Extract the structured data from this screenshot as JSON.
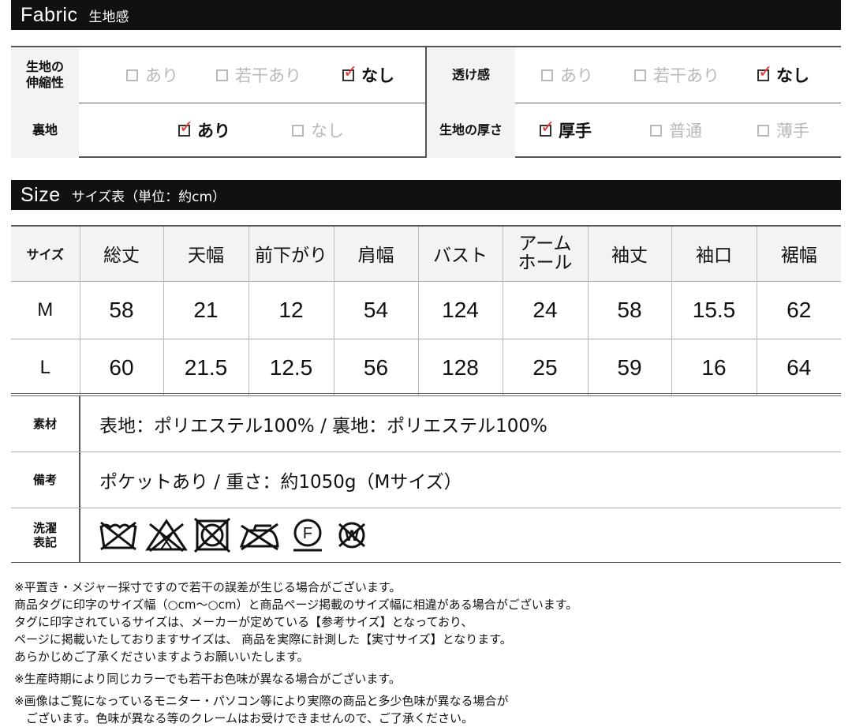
{
  "fabric_section": {
    "title_en": "Fabric",
    "title_jp": "生地感"
  },
  "fabric": {
    "stretch": {
      "label": "生地の\n伸縮性",
      "options": [
        {
          "text": "あり",
          "checked": false
        },
        {
          "text": "若干あり",
          "checked": false
        },
        {
          "text": "なし",
          "checked": true
        }
      ]
    },
    "sheer": {
      "label": "透け感",
      "options": [
        {
          "text": "あり",
          "checked": false
        },
        {
          "text": "若干あり",
          "checked": false
        },
        {
          "text": "なし",
          "checked": true
        }
      ]
    },
    "lining": {
      "label": "裏地",
      "options": [
        {
          "text": "あり",
          "checked": true
        },
        {
          "text": "なし",
          "checked": false
        }
      ]
    },
    "thickness": {
      "label": "生地の厚さ",
      "options": [
        {
          "text": "厚手",
          "checked": true
        },
        {
          "text": "普通",
          "checked": false
        },
        {
          "text": "薄手",
          "checked": false
        }
      ]
    }
  },
  "size_section": {
    "title_en": "Size",
    "title_jp": "サイズ表（単位：約cm）"
  },
  "size_table": {
    "headers": [
      "サイズ",
      "総丈",
      "天幅",
      "前下がり",
      "肩幅",
      "バスト",
      "アーム\nホール",
      "袖丈",
      "袖口",
      "裾幅"
    ],
    "rows": [
      [
        "M",
        "58",
        "21",
        "12",
        "54",
        "124",
        "24",
        "58",
        "15.5",
        "62"
      ],
      [
        "L",
        "60",
        "21.5",
        "12.5",
        "56",
        "128",
        "25",
        "59",
        "16",
        "64"
      ]
    ]
  },
  "info": {
    "material_label": "素材",
    "material": "表地：ポリエステル100% / 裏地：ポリエステル100%",
    "remarks_label": "備考",
    "remarks": "ポケットあり / 重さ：約1050g（Mサイズ）",
    "care_label": "洗濯\n表記",
    "care_icons": [
      "no-wash-icon",
      "no-bleach-icon",
      "no-tumble-dry-icon",
      "no-iron-icon",
      "dry-clean-f-icon",
      "no-wet-clean-icon"
    ],
    "care_letters": {
      "dry_clean": "F",
      "wet_clean": "W"
    }
  },
  "notes": [
    "※平置き・メジャー採寸ですので若干の誤差が生じる場合がございます。",
    "商品タグに印字のサイズ幅（○cm〜○cm）と商品ページ掲載のサイズ幅に相違がある場合がございます。",
    "タグに印字されているサイズは、メーカーが定めている【参考サイズ】となっており、",
    "ページに掲載いたしておりますサイズは、 商品を実際に計測した【実寸サイズ】となります。",
    "あらかじめご了承くださいますようお願いいたします。",
    "※生産時期により同じカラーでも若干お色味が異なる場合がございます。",
    "※画像はご覧になっているモニター・パソコン等により実際の商品と多少色味が異なる場合が",
    "　ございます。色味が異なる等のクレームはお受けできませんので、ご了承ください。"
  ],
  "colors": {
    "bar": "#111111",
    "check": "#e53935",
    "inactive": "#b9b9b9",
    "label_bg": "#f3f3f3"
  }
}
